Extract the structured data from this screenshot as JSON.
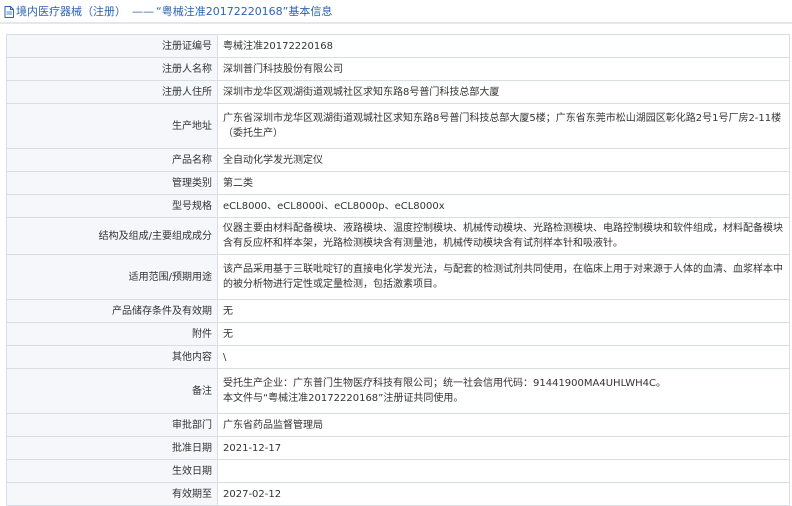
{
  "header": {
    "section": "境内医疗器械（注册）",
    "separator": "——",
    "title": "“粤械注准20172220168”基本信息"
  },
  "rows": [
    {
      "label": "注册证编号",
      "value": "粤械注准20172220168"
    },
    {
      "label": "注册人名称",
      "value": "深圳普门科技股份有限公司"
    },
    {
      "label": "注册人住所",
      "value": "深圳市龙华区观湖街道观城社区求知东路8号普门科技总部大厦"
    },
    {
      "label": "生产地址",
      "value": "广东省深圳市龙华区观湖街道观城社区求知东路8号普门科技总部大厦5楼；广东省东莞市松山湖园区彰化路2号1号厂房2-11楼（委托生产）"
    },
    {
      "label": "产品名称",
      "value": "全自动化学发光测定仪"
    },
    {
      "label": "管理类别",
      "value": "第二类"
    },
    {
      "label": "型号规格",
      "value": "eCL8000、eCL8000i、eCL8000p、eCL8000x"
    },
    {
      "label": "结构及组成/主要组成成分",
      "value": "仪器主要由材料配备模块、液路模块、温度控制模块、机械传动模块、光路检测模块、电路控制模块和软件组成，材料配备模块含有反应杯和样本架，光路检测模块含有测量池，机械传动模块含有试剂样本针和吸液针。"
    },
    {
      "label": "适用范围/预期用途",
      "value": "该产品采用基于三联吡啶钌的直接电化学发光法，与配套的检测试剂共同使用，在临床上用于对来源于人体的血清、血浆样本中的被分析物进行定性或定量检测，包括激素项目。"
    },
    {
      "label": "产品储存条件及有效期",
      "value": "无"
    },
    {
      "label": "附件",
      "value": "无"
    },
    {
      "label": "其他内容",
      "value": "\\"
    },
    {
      "label": "备注",
      "value": "受托生产企业：广东普门生物医疗科技有限公司；统一社会信用代码：91441900MA4UHLWH4C。",
      "value2": "本文件与“粤械注准20172220168”注册证共同使用。"
    },
    {
      "label": "审批部门",
      "value": "广东省药品监督管理局"
    },
    {
      "label": "批准日期",
      "value": "2021-12-17"
    },
    {
      "label": "生效日期",
      "value": ""
    },
    {
      "label": "有效期至",
      "value": "2027-02-12"
    }
  ]
}
